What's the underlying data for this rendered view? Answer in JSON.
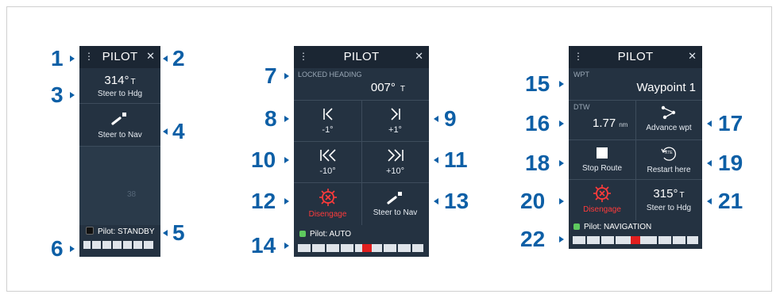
{
  "callouts": [
    "1",
    "2",
    "3",
    "4",
    "5",
    "6",
    "7",
    "8",
    "9",
    "10",
    "11",
    "12",
    "13",
    "14",
    "15",
    "16",
    "17",
    "18",
    "19",
    "20",
    "21",
    "22"
  ],
  "colors": {
    "panel": "#243241",
    "header": "#1b2633",
    "callout": "#0d5fa6",
    "danger": "#ff3b3b",
    "status_ok": "#5ec95e"
  },
  "panel1": {
    "menu": "⋮",
    "title": "PILOT",
    "close": "✕",
    "heading": "314°",
    "heading_unit": "T",
    "steer_hdg": "Steer to Hdg",
    "steer_nav": "Steer to Nav",
    "status": "Pilot: STANDBY",
    "icons": [
      "menu-icon",
      "close-icon",
      "steer-to-nav-icon"
    ]
  },
  "panel2": {
    "menu": "⋮",
    "title": "PILOT",
    "close": "✕",
    "locked_label": "LOCKED HEADING",
    "locked_value": "007°",
    "locked_unit": "T",
    "minus1": "-1°",
    "plus1": "+1°",
    "minus10": "-10°",
    "plus10": "+10°",
    "disengage": "Disengage",
    "steer_nav": "Steer to Nav",
    "status": "Pilot: AUTO",
    "rudder_position": 0.55
  },
  "panel3": {
    "menu": "⋮",
    "title": "PILOT",
    "close": "✕",
    "wpt_label": "WPT",
    "wpt_value": "Waypoint 1",
    "dtw_label": "DTW",
    "dtw_value": "1.77",
    "dtw_unit": "nm",
    "advance": "Advance wpt",
    "stop": "Stop Route",
    "restart": "Restart here",
    "restart_icon_text": "XTE",
    "disengage": "Disengage",
    "heading": "315°",
    "heading_unit": "T",
    "steer_hdg": "Steer to Hdg",
    "status": "Pilot: NAVIGATION",
    "rudder_position": 0.5
  }
}
